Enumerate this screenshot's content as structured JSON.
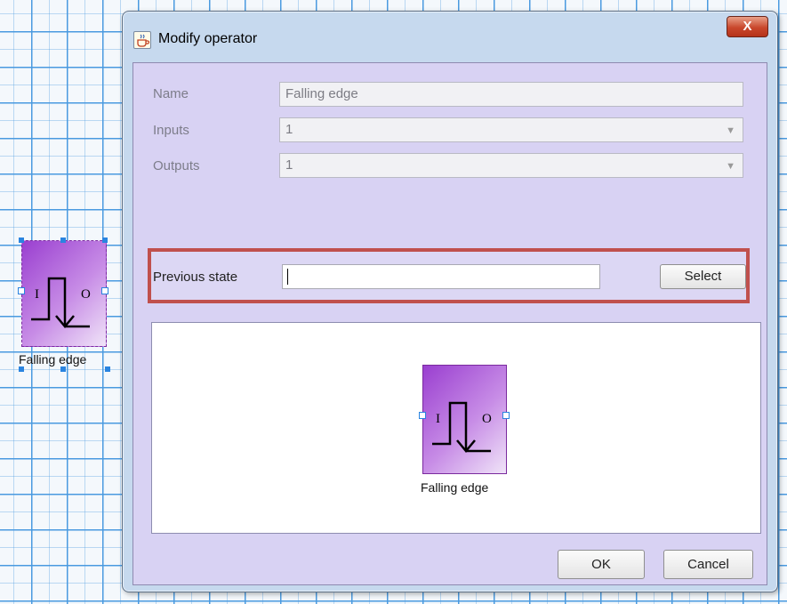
{
  "canvas": {
    "operator": {
      "label": "Falling edge",
      "input_port": "I",
      "output_port": "O"
    }
  },
  "dialog": {
    "title": "Modify operator",
    "close_label": "X",
    "fields": {
      "name": {
        "label": "Name",
        "value": "Falling edge"
      },
      "inputs": {
        "label": "Inputs",
        "value": "1"
      },
      "outputs": {
        "label": "Outputs",
        "value": "1"
      }
    },
    "previous_state": {
      "label": "Previous state",
      "value": "",
      "select_label": "Select"
    },
    "preview": {
      "operator": {
        "label": "Falling edge",
        "input_port": "I",
        "output_port": "O"
      }
    },
    "buttons": {
      "ok": "OK",
      "cancel": "Cancel"
    }
  },
  "colors": {
    "highlight_border": "#c0504d",
    "operator_gradient_start": "#9a3fd0",
    "operator_gradient_end": "#f0e4f8",
    "grid_line": "#4a9ae0"
  },
  "icons": {
    "title": "java-cup-icon",
    "operator_symbol": "falling-edge-symbol-icon"
  }
}
